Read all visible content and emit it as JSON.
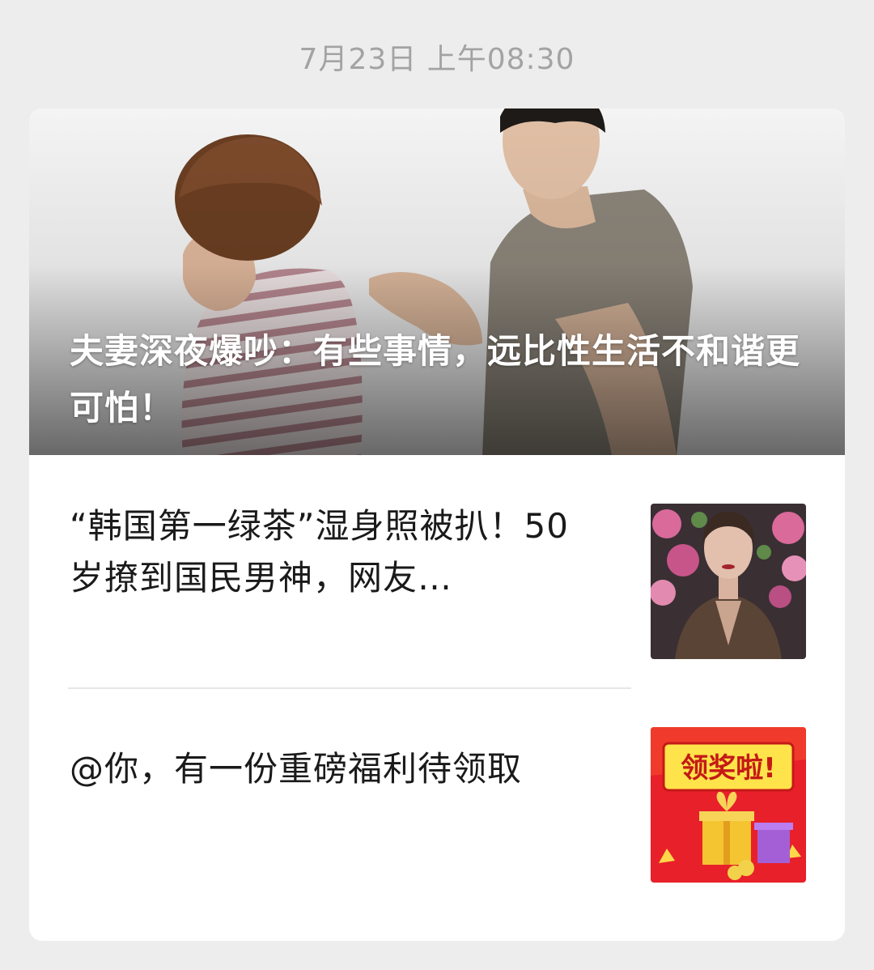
{
  "timestamp": "7月23日 上午08:30",
  "articles": [
    {
      "title": "夫妻深夜爆吵：有些事情，远比性生活不和谐更可怕！"
    },
    {
      "title": "“韩国第一绿茶”湿身照被扒！50 岁撩到国民男神，网友…"
    },
    {
      "title": "@你，有一份重磅福利待领取"
    }
  ],
  "thumb_prize": {
    "text": "领奖啦!"
  },
  "colors": {
    "background": "#ededed",
    "card": "#ffffff",
    "timestamp": "#a3a3a3",
    "prize_red": "#e8202a",
    "prize_yellow": "#ffe34a"
  },
  "icons": {
    "cover": "couple-arguing-photo",
    "thumb_1": "woman-portrait-photo",
    "thumb_2": "prize-gift-banner"
  }
}
